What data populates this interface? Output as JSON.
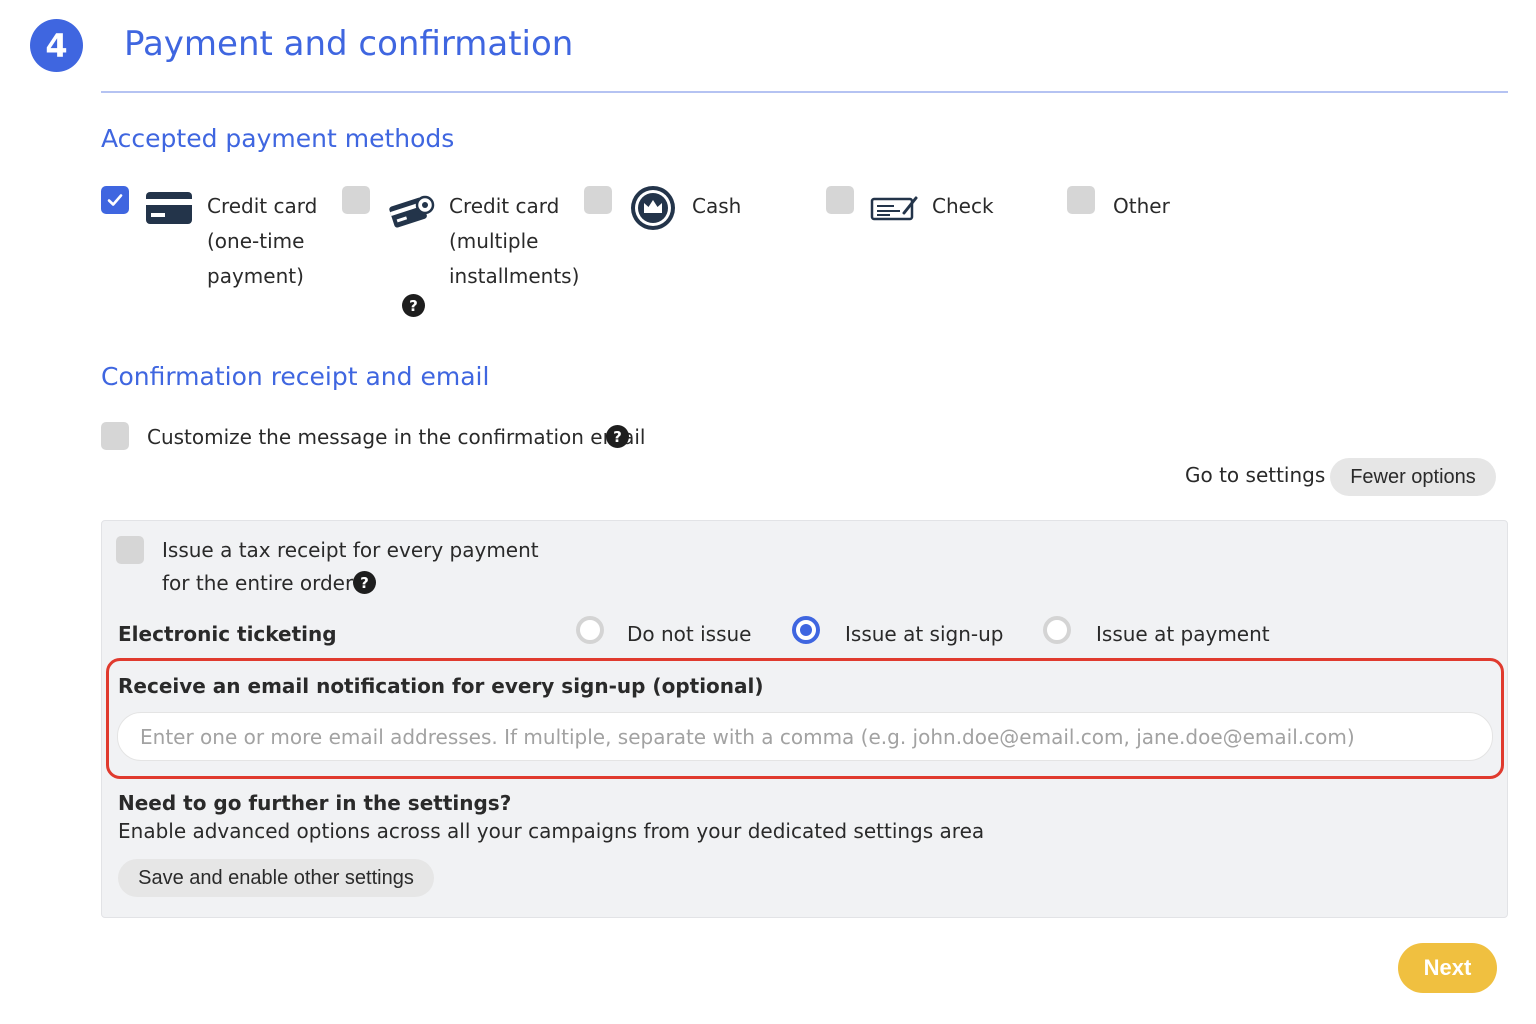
{
  "step": {
    "number": "4",
    "title": "Payment and confirmation"
  },
  "payment_methods": {
    "title": "Accepted payment methods",
    "items": [
      {
        "label": [
          "Credit card",
          "(one-time",
          "payment)"
        ],
        "checked": true,
        "icon": "credit-card-icon"
      },
      {
        "label": [
          "Credit card",
          "(multiple",
          "installments)"
        ],
        "checked": false,
        "icon": "credit-card-installments-icon",
        "has_help": true
      },
      {
        "label": [
          "Cash"
        ],
        "checked": false,
        "icon": "cash-icon"
      },
      {
        "label": [
          "Check"
        ],
        "checked": false,
        "icon": "check-icon"
      },
      {
        "label": [
          "Other"
        ],
        "checked": false
      }
    ]
  },
  "confirmation": {
    "title": "Confirmation receipt and email",
    "customize_label": "Customize the message in the confirmation email",
    "go_to_settings": "Go to settings",
    "fewer_options": "Fewer options"
  },
  "panel": {
    "tax_receipt_line1": "Issue a tax receipt for every payment",
    "tax_receipt_line2": "for the entire order",
    "ticketing_label": "Electronic ticketing",
    "ticketing_options": [
      "Do not issue",
      "Issue at sign-up",
      "Issue at payment"
    ],
    "ticketing_selected": "Issue at sign-up",
    "notification_label": "Receive an email notification for every sign-up (optional)",
    "notification_placeholder": "Enter one or more email addresses. If multiple, separate with a comma (e.g. john.doe@email.com, jane.doe@email.com)",
    "notification_value": "",
    "further_title": "Need to go further in the settings?",
    "further_desc": "Enable advanced options across all your campaigns from your dedicated settings area",
    "save_button": "Save and enable other settings"
  },
  "next_button": "Next",
  "colors": {
    "accent": "#3f66e0",
    "highlight": "#e03a2e",
    "next": "#f0c040"
  }
}
